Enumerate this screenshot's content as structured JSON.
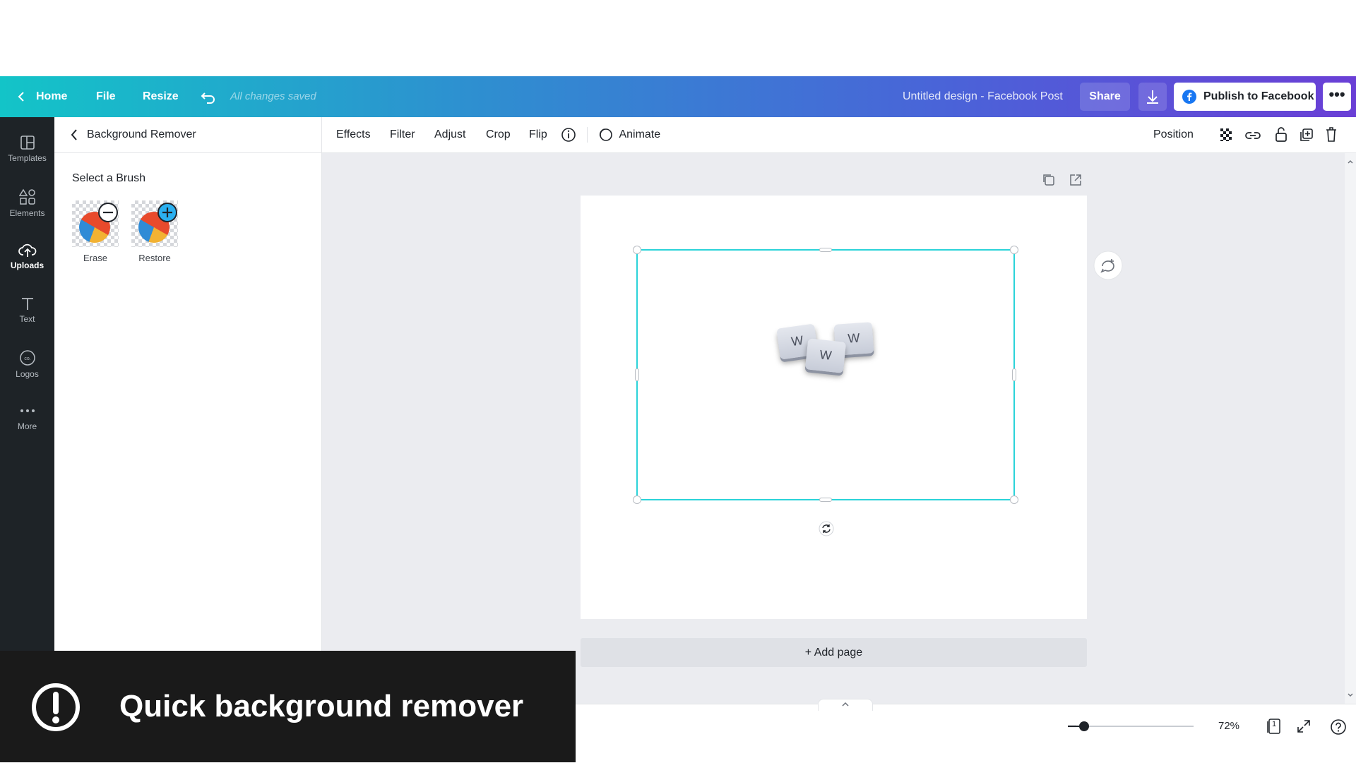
{
  "topbar": {
    "home": "Home",
    "file": "File",
    "resize": "Resize",
    "saved_status": "All changes saved",
    "design_title": "Untitled design - Facebook Post",
    "share": "Share",
    "publish": "Publish to Facebook"
  },
  "rail": {
    "items": [
      {
        "label": "Templates",
        "icon": "templates-icon"
      },
      {
        "label": "Elements",
        "icon": "elements-icon"
      },
      {
        "label": "Uploads",
        "icon": "upload-cloud-icon"
      },
      {
        "label": "Text",
        "icon": "text-icon"
      },
      {
        "label": "Logos",
        "icon": "logos-icon"
      },
      {
        "label": "More",
        "icon": "more-dots-icon"
      }
    ],
    "active": "Uploads"
  },
  "panel": {
    "title": "Background Remover",
    "section": "Select a Brush",
    "brushes": [
      {
        "label": "Erase",
        "icon": "minus-circle-icon"
      },
      {
        "label": "Restore",
        "icon": "plus-circle-icon"
      }
    ]
  },
  "toolbar": {
    "effects": "Effects",
    "filter": "Filter",
    "adjust": "Adjust",
    "crop": "Crop",
    "flip": "Flip",
    "animate": "Animate",
    "position": "Position"
  },
  "canvas": {
    "keycaps": [
      "W",
      "W",
      "W"
    ],
    "add_page": "+ Add page"
  },
  "footer": {
    "zoom_label": "72%",
    "zoom_value": 0.72,
    "page_count": "1"
  },
  "banner": {
    "text": "Quick background remover"
  },
  "colors": {
    "gradient_start": "#13c4c8",
    "gradient_end": "#6a3fd6",
    "selection": "#2bd3d9",
    "rail_bg": "#1e2327",
    "canvas_bg": "#ebecf0",
    "facebook_blue": "#1877f2"
  }
}
